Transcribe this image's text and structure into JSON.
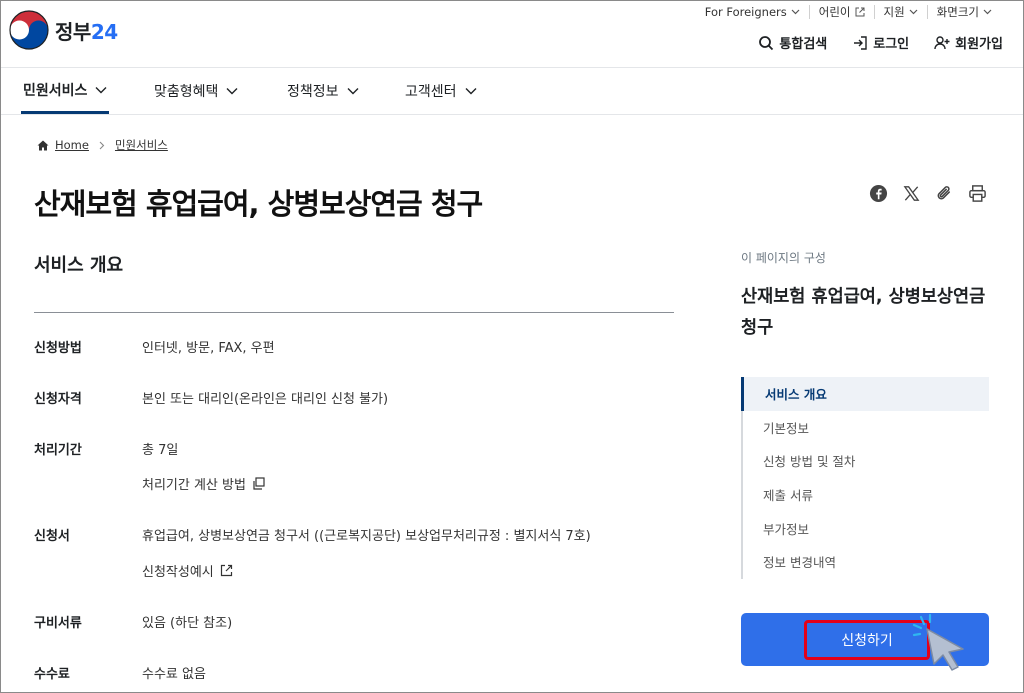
{
  "header": {
    "logo_text": "정부",
    "logo_num": "24",
    "util": [
      {
        "label": "For Foreigners"
      },
      {
        "label": "어린이"
      },
      {
        "label": "지원"
      },
      {
        "label": "화면크기"
      }
    ],
    "menu": {
      "search": "통합검색",
      "login": "로그인",
      "signup": "회원가입"
    }
  },
  "gnb": [
    {
      "label": "민원서비스"
    },
    {
      "label": "맞춤형혜택"
    },
    {
      "label": "정책정보"
    },
    {
      "label": "고객센터"
    }
  ],
  "breadcrumb": {
    "home": "Home",
    "current": "민원서비스"
  },
  "page_title": "산재보험 휴업급여, 상병보상연금 청구",
  "section_title": "서비스 개요",
  "rows": {
    "method": {
      "label": "신청방법",
      "value": "인터넷, 방문, FAX, 우편"
    },
    "qualification": {
      "label": "신청자격",
      "value": "본인 또는 대리인(온라인은 대리인 신청 불가)"
    },
    "period": {
      "label": "처리기간",
      "value": "총 7일",
      "link": "처리기간 계산 방법"
    },
    "form": {
      "label": "신청서",
      "value": "휴업급여, 상병보상연금 청구서 ((근로복지공단) 보상업무처리규정 : 별지서식 7호)",
      "link": "신청작성예시"
    },
    "documents": {
      "label": "구비서류",
      "value": "있음 (하단 참조)"
    },
    "fee": {
      "label": "수수료",
      "value": "수수료 없음"
    }
  },
  "side": {
    "caption": "이 페이지의 구성",
    "title": "산재보험 휴업급여, 상병보상연금 청구",
    "toc": [
      {
        "label": "서비스 개요"
      },
      {
        "label": "기본정보"
      },
      {
        "label": "신청 방법 및 절차"
      },
      {
        "label": "제출 서류"
      },
      {
        "label": "부가정보"
      },
      {
        "label": "정보 변경내역"
      }
    ],
    "apply_button": "신청하기"
  },
  "colors": {
    "primary": "#2f6fe9",
    "navy": "#063a74",
    "highlight": "#e3001b"
  }
}
